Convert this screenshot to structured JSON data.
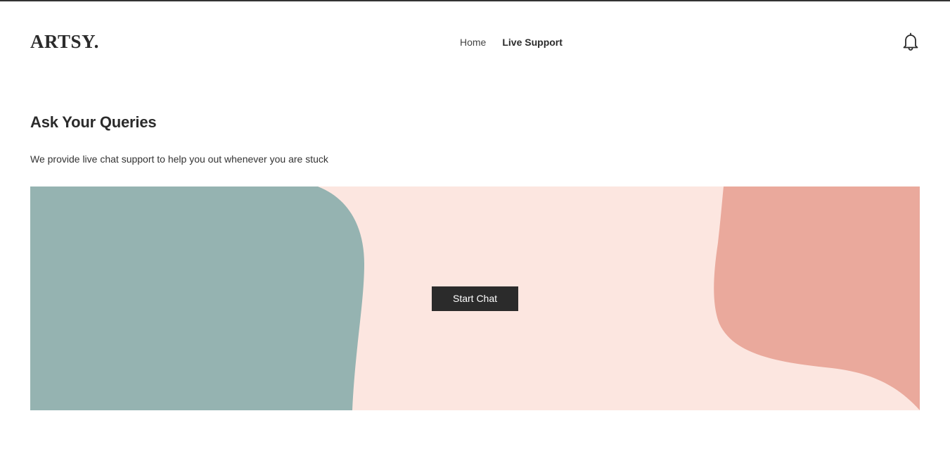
{
  "header": {
    "logo": "ARTSY.",
    "nav": {
      "home": "Home",
      "live_support": "Live Support"
    },
    "notification_icon": "bell-icon"
  },
  "main": {
    "title": "Ask Your Queries",
    "subtitle": "We provide live chat support to help you out whenever you are stuck",
    "banner": {
      "button_label": "Start Chat",
      "colors": {
        "background": "#fce6e0",
        "left_blob": "#95b3b1",
        "right_blob": "#eaa99c"
      }
    }
  }
}
